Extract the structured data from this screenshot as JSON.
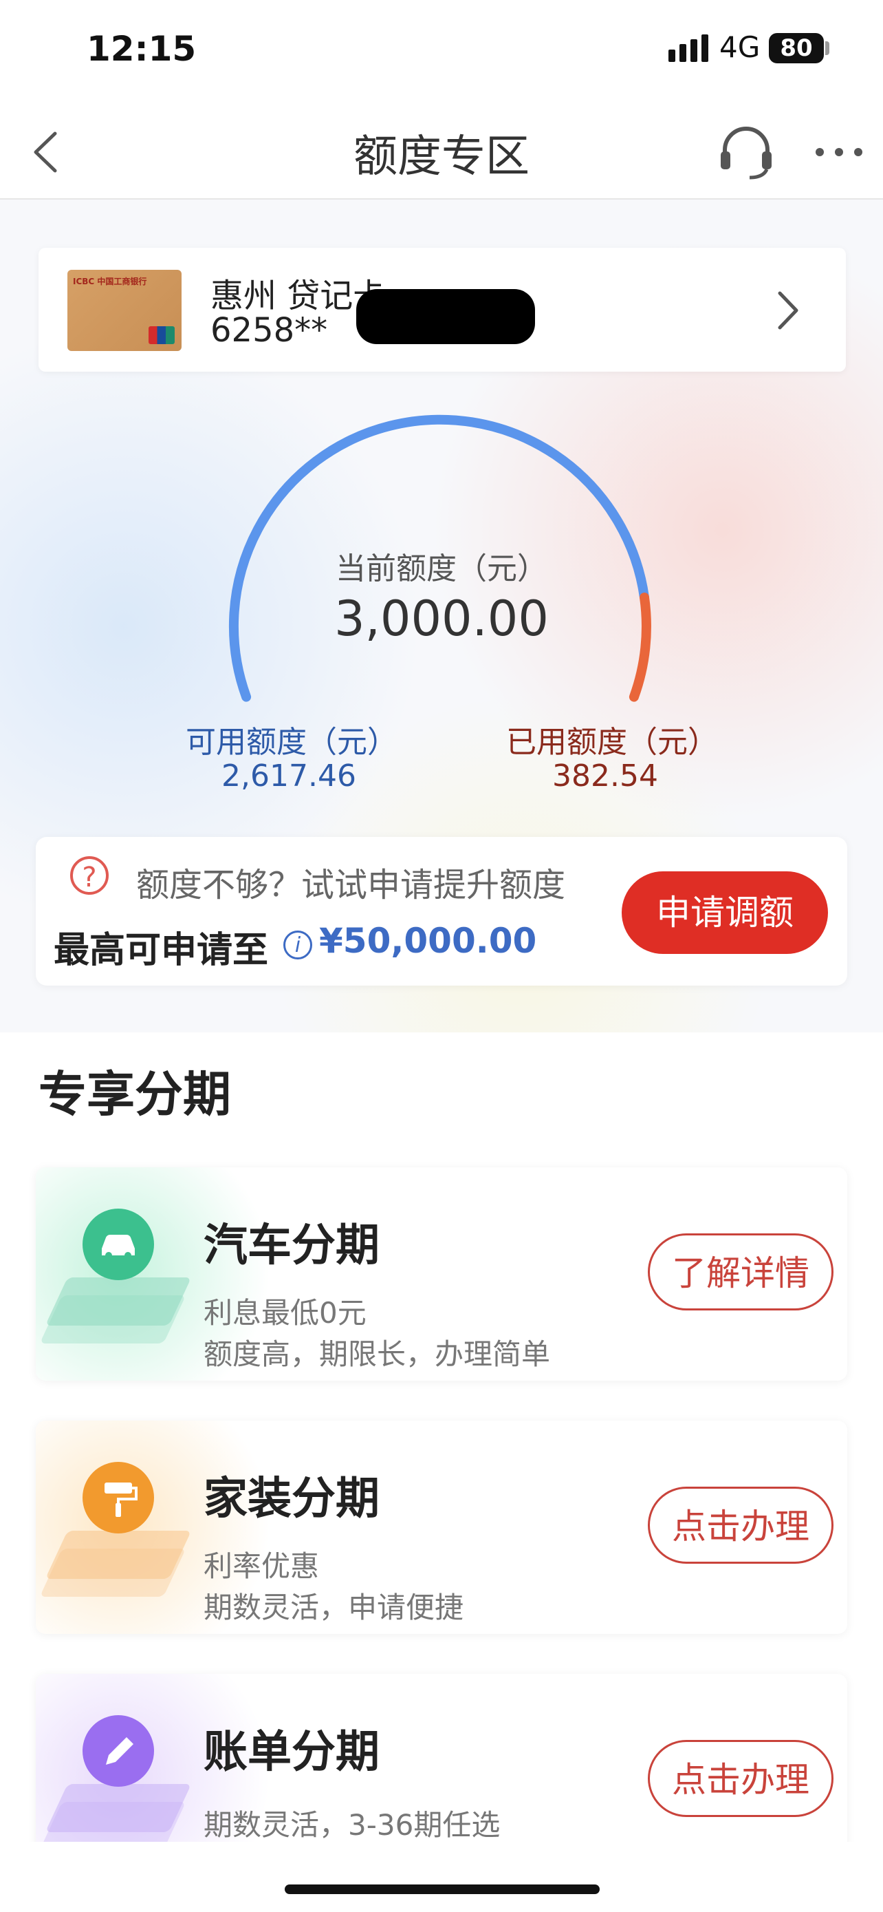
{
  "status_bar": {
    "time": "12:15",
    "network": "4G",
    "battery": "80"
  },
  "nav": {
    "title": "额度专区"
  },
  "card": {
    "name": "惠州 贷记卡",
    "number": "6258**",
    "bank_logo_text": "ICBC 中国工商银行"
  },
  "credit": {
    "current_label": "当前额度（元）",
    "current_value": "3,000.00",
    "available_label": "可用额度（元）",
    "available_value": "2,617.46",
    "used_label": "已用额度（元）",
    "used_value": "382.54",
    "used_fraction": 0.1275,
    "colors": {
      "available": "#5b95ec",
      "used": "#e9663a"
    }
  },
  "promo": {
    "question": "额度不够？试试申请提升额度",
    "max_label": "最高可申请至",
    "max_value": "¥50,000.00",
    "apply_button": "申请调额"
  },
  "section": {
    "title": "专享分期"
  },
  "installments": [
    {
      "name": "汽车分期",
      "desc1": "利息最低0元",
      "desc2": "额度高，期限长，办理简单",
      "button": "了解详情",
      "icon": "car-icon",
      "color": "#3cc08e"
    },
    {
      "name": "家装分期",
      "desc1": "利率优惠",
      "desc2": "期数灵活，申请便捷",
      "button": "点击办理",
      "icon": "paint-roller-icon",
      "color": "#f29a2e"
    },
    {
      "name": "账单分期",
      "desc1": "期数灵活，3-36期任选",
      "desc2": "",
      "button": "点击办理",
      "icon": "pen-icon",
      "color": "#9a6ef0"
    }
  ]
}
